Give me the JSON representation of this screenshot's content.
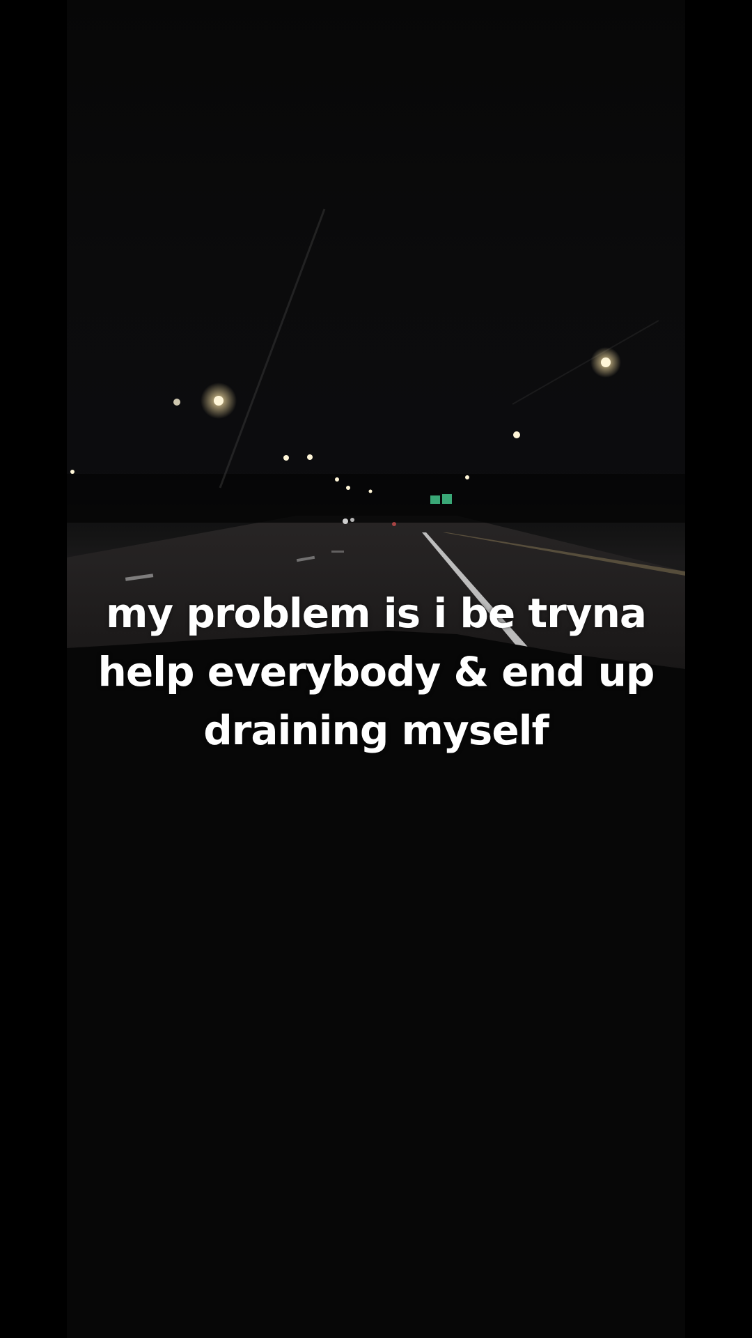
{
  "caption": {
    "lines": [
      "my problem is i be tryna",
      "help everybody & end up",
      "draining myself"
    ]
  },
  "colors": {
    "background": "#000000",
    "text": "#ffffff",
    "street_light": "#fff6d8",
    "sign_green": "#3aa877",
    "lane_marking": "#d8d8d8"
  }
}
